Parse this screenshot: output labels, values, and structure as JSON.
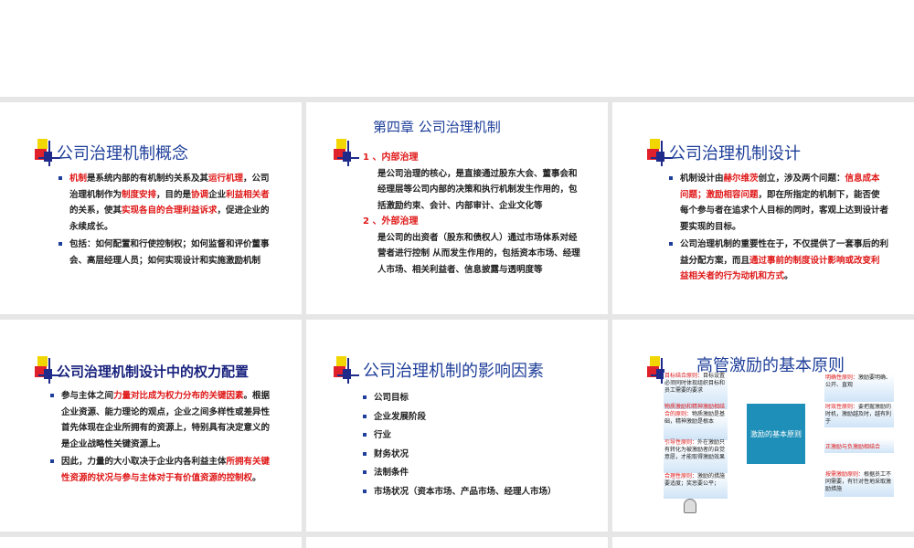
{
  "slide1": {
    "title": "公司治理机制概念",
    "b1": {
      "p1": "机制",
      "p2": "是系统内部的有机制约关系及其",
      "p3": "运行机理",
      "p4": "，公司治理机制作为",
      "p5": "制度安排",
      "p6": "，目的是",
      "p7": "协调",
      "p8": "企业",
      "p9": "利益相关者",
      "p10": "的关系，使其",
      "p11": "实现各自的合理利益诉求",
      "p12": "，促进企业的永续成长。"
    },
    "b2": "包括：如何配置和行使控制权；如何监督和评价董事会、高层经理人员；如何实现设计和实施激励机制"
  },
  "slide2": {
    "title": "第四章 公司治理机制",
    "h1": "1 、内部治理",
    "t1": "是公司治理的核心，是直接通过股东大会、董事会和经理层等公司内部的决策和执行机制发生作用的，包括激励约束、会计、内部审计、企业文化等",
    "h2": "2 、外部治理",
    "t2": "是公司的出资者（股东和债权人）通过市场体系对经营者进行控制 从而发生作用的，包括资本市场、经理人市场、相关利益者、信息披露与透明度等"
  },
  "slide3": {
    "title": "公司治理机制设计",
    "b1": {
      "p1": "机制设计由",
      "p2": "赫尔维茨",
      "p3": "创立，涉及两个问题：",
      "p4": "信息成本问题；激励相容问题",
      "p5": "，即在所指定的机制下，能否使每个参与者在追求个人目标的同时，客观上达到设计者要实现的目标。"
    },
    "b2": {
      "p1": "公司治理机制的重要性在于，不仅提供了一套事后的利益分配方案，而且",
      "p2": "通过事前的制度设计影响或改变利益相关者的行为动机和方式",
      "p3": "。"
    }
  },
  "slide4": {
    "title": "公司治理机制设计中的权力配置",
    "b1": {
      "p1": "参与主体之间",
      "p2": "力量对比成为权力分布的关键因素",
      "p3": "。根据企业资源、能力理论的观点，企业之间多样性或差异性首先体现在企业所拥有的资源上，特别具有决定意义的是企业战略性关键资源上。"
    },
    "b2": {
      "p1": "因此，力量的大小取决于企业内各利益主体",
      "p2": "所拥有关键性资源的状况与参与主体对于有价值资源的控制权",
      "p3": "。"
    }
  },
  "slide5": {
    "title": "公司治理机制的影响因素",
    "items": [
      "公司目标",
      "企业发展阶段",
      "行业",
      "财务状况",
      "法制条件",
      "市场状况（资本市场、产品市场、经理人市场）"
    ]
  },
  "slide6": {
    "title": "高管激励的基本原则",
    "center": "激励的基本原则",
    "left": [
      {
        "label": "目标结合原则：",
        "text": "目标设置必须同时体现组织目标和员工需要的要求"
      },
      {
        "label": "物质激励和精神激励相结合的原则：",
        "text": "物质激励是基础，精神激励是根本"
      },
      {
        "label": "引导性原则：",
        "text": "外在激励只有转化为被激励者的自觉意愿，才能取得激励效果"
      },
      {
        "label": "合理性原则：",
        "text": "激励的措施要适度；奖惩要公平；"
      }
    ],
    "right": [
      {
        "label": "明确性原则：",
        "text": "激励要明确、公开、直观"
      },
      {
        "label": "时效性原则：",
        "text": "要把握激励的时机，激励越及时，越有利于"
      },
      {
        "label": "正激励与负激励相结合",
        "text": ""
      },
      {
        "label": "按需激励原则：",
        "text": "根据员工不同需要，有针对性地采取激励措施"
      }
    ]
  }
}
